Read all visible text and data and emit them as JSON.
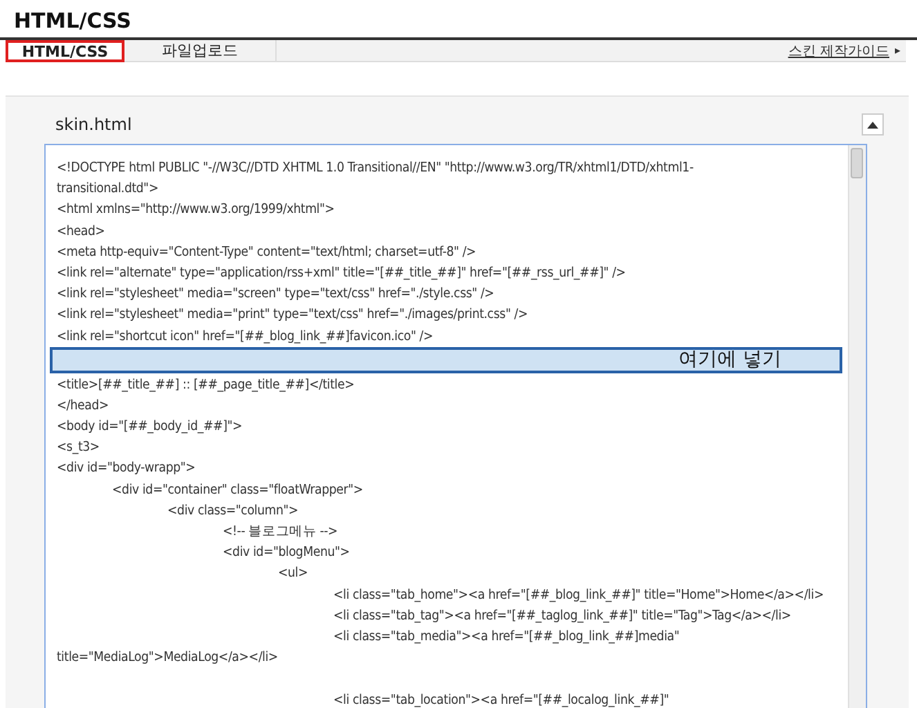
{
  "page_title": "HTML/CSS",
  "tabs": [
    {
      "label": "HTML/CSS",
      "selected": true,
      "annotated": true
    },
    {
      "label": "파일업로드",
      "selected": false,
      "annotated": false
    }
  ],
  "guide_link": {
    "label": "스킨 제작가이드",
    "arrow": "▸"
  },
  "editor": {
    "file_name": "skin.html",
    "lines": [
      {
        "kind": "code",
        "text": "<!DOCTYPE html PUBLIC \"-//W3C//DTD XHTML 1.0 Transitional//EN\" \"http://www.w3.org/TR/xhtml1/DTD/xhtml1-"
      },
      {
        "kind": "code",
        "text": "transitional.dtd\">"
      },
      {
        "kind": "code",
        "text": "<html xmlns=\"http://www.w3.org/1999/xhtml\">"
      },
      {
        "kind": "code",
        "text": "<head>"
      },
      {
        "kind": "code",
        "text": "<meta http-equiv=\"Content-Type\" content=\"text/html; charset=utf-8\" />"
      },
      {
        "kind": "code",
        "text": "<link rel=\"alternate\" type=\"application/rss+xml\" title=\"[##_title_##]\" href=\"[##_rss_url_##]\" />"
      },
      {
        "kind": "code",
        "text": "<link rel=\"stylesheet\" media=\"screen\" type=\"text/css\" href=\"./style.css\" />"
      },
      {
        "kind": "code",
        "text": "<link rel=\"stylesheet\" media=\"print\" type=\"text/css\" href=\"./images/print.css\" />"
      },
      {
        "kind": "code",
        "text": "<link rel=\"shortcut icon\" href=\"[##_blog_link_##]favicon.ico\" />"
      },
      {
        "kind": "annotation",
        "text": "여기에 넣기"
      },
      {
        "kind": "code",
        "text": "<title>[##_title_##] :: [##_page_title_##]</title>"
      },
      {
        "kind": "code",
        "text": "</head>"
      },
      {
        "kind": "code",
        "text": "<body id=\"[##_body_id_##]\">"
      },
      {
        "kind": "code",
        "text": "<s_t3>"
      },
      {
        "kind": "code",
        "text": "<div id=\"body-wrapp\">"
      },
      {
        "kind": "code",
        "text": "\t<div id=\"container\" class=\"floatWrapper\">"
      },
      {
        "kind": "code",
        "text": "\t\t<div class=\"column\">"
      },
      {
        "kind": "code",
        "text": "\t\t\t<!-- 블로그메뉴 -->"
      },
      {
        "kind": "code",
        "text": "\t\t\t<div id=\"blogMenu\">"
      },
      {
        "kind": "code",
        "text": "\t\t\t\t<ul>"
      },
      {
        "kind": "code",
        "text": "\t\t\t\t\t<li class=\"tab_home\"><a href=\"[##_blog_link_##]\" title=\"Home\">Home</a></li>"
      },
      {
        "kind": "code",
        "text": "\t\t\t\t\t<li class=\"tab_tag\"><a href=\"[##_taglog_link_##]\" title=\"Tag\">Tag</a></li>"
      },
      {
        "kind": "code",
        "text": "\t\t\t\t\t<li class=\"tab_media\"><a href=\"[##_blog_link_##]media\""
      },
      {
        "kind": "code",
        "text": "title=\"MediaLog\">MediaLog</a></li>"
      },
      {
        "kind": "blank"
      },
      {
        "kind": "code",
        "text": "\t\t\t\t\t<li class=\"tab_location\"><a href=\"[##_localog_link_##]\""
      }
    ]
  }
}
